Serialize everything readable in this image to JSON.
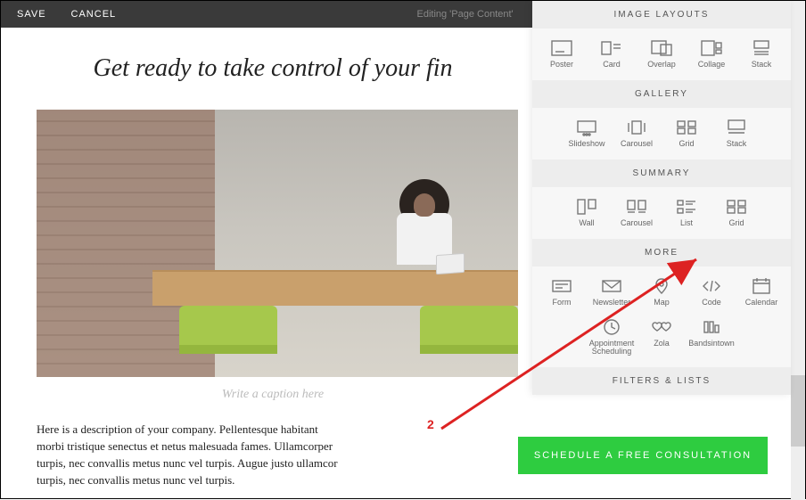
{
  "topbar": {
    "save": "SAVE",
    "cancel": "CANCEL",
    "title": "Editing 'Page Content'"
  },
  "page": {
    "headline": "Get ready to take control of your fin",
    "caption": "Write a caption here",
    "description": "Here is a description of your company. Pellentesque habitant morbi tristique senectus et netus malesuada fames. Ullamcorper turpis, nec convallis metus nunc vel turpis. Augue justo ullamcor turpis, nec convallis metus nunc vel turpis.",
    "cta": "SCHEDULE A FREE CONSULTATION"
  },
  "panel": {
    "sections": [
      {
        "title": "IMAGE LAYOUTS",
        "items": [
          {
            "label": "Poster"
          },
          {
            "label": "Card"
          },
          {
            "label": "Overlap"
          },
          {
            "label": "Collage"
          },
          {
            "label": "Stack"
          }
        ]
      },
      {
        "title": "GALLERY",
        "items": [
          {
            "label": "Slideshow"
          },
          {
            "label": "Carousel"
          },
          {
            "label": "Grid"
          },
          {
            "label": "Stack"
          }
        ]
      },
      {
        "title": "SUMMARY",
        "items": [
          {
            "label": "Wall"
          },
          {
            "label": "Carousel"
          },
          {
            "label": "List"
          },
          {
            "label": "Grid"
          }
        ]
      },
      {
        "title": "MORE",
        "items": [
          {
            "label": "Form"
          },
          {
            "label": "Newsletter"
          },
          {
            "label": "Map"
          },
          {
            "label": "Code"
          },
          {
            "label": "Calendar"
          },
          {
            "label": "Appointment Scheduling"
          },
          {
            "label": "Zola"
          },
          {
            "label": "Bandsintown"
          }
        ]
      },
      {
        "title": "FILTERS & LISTS",
        "items": []
      }
    ]
  },
  "annotation": {
    "label": "2"
  }
}
